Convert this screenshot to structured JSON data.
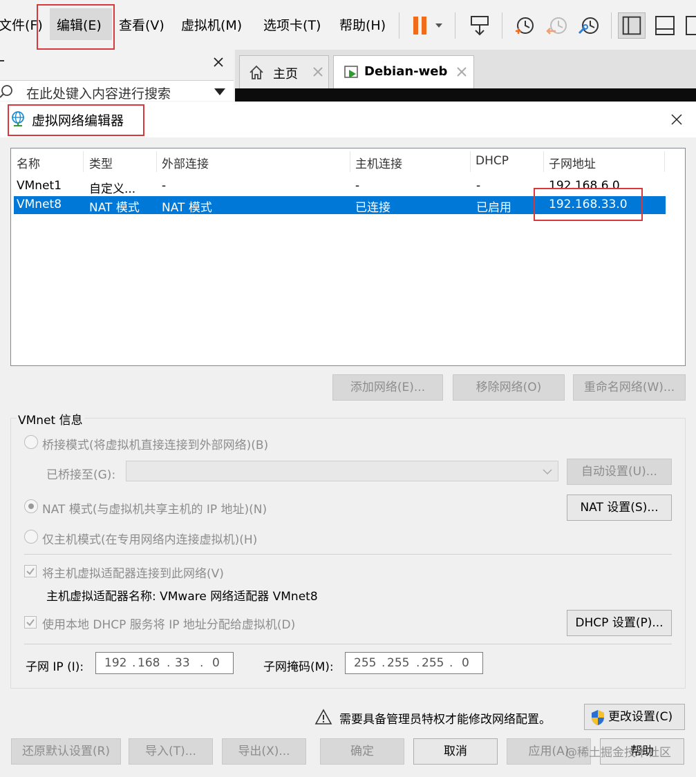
{
  "menubar": {
    "items": [
      "文件(F)",
      "编辑(E)",
      "查看(V)",
      "虚拟机(M)",
      "选项卡(T)",
      "帮助(H)"
    ]
  },
  "colors": {
    "accent": "#0078d7",
    "highlight_box": "#d9383a",
    "pause": "#ef6c1a"
  },
  "library": {
    "search_placeholder": "在此处键入内容进行搜索"
  },
  "tabs": [
    {
      "label": "主页"
    },
    {
      "label": "Debian-web"
    }
  ],
  "dialog": {
    "title": "虚拟网络编辑器",
    "columns": [
      "名称",
      "类型",
      "外部连接",
      "主机连接",
      "DHCP",
      "子网地址"
    ],
    "rows": [
      {
        "name": "VMnet1",
        "type": "自定义...",
        "external": "-",
        "host": "-",
        "dhcp": "-",
        "subnet": "192.168.6.0"
      },
      {
        "name": "VMnet8",
        "type": "NAT 模式",
        "external": "NAT 模式",
        "host": "已连接",
        "dhcp": "已启用",
        "subnet": "192.168.33.0"
      }
    ],
    "list_buttons": {
      "add": "添加网络(E)...",
      "remove": "移除网络(O)",
      "rename": "重命名网络(W)..."
    },
    "group": {
      "title": "VMnet 信息",
      "bridge_label": "桥接模式(将虚拟机直接连接到外部网络)(B)",
      "bridged_to_label": "已桥接至(G):",
      "auto_button": "自动设置(U)...",
      "nat_label": "NAT 模式(与虚拟机共享主机的 IP 地址)(N)",
      "nat_button": "NAT 设置(S)...",
      "hostonly_label": "仅主机模式(在专用网络内连接虚拟机)(H)",
      "connect_adapter_label": "将主机虚拟适配器连接到此网络(V)",
      "adapter_name_label": "主机虚拟适配器名称: VMware 网络适配器 VMnet8",
      "dhcp_label": "使用本地 DHCP 服务将 IP 地址分配给虚拟机(D)",
      "dhcp_button": "DHCP 设置(P)...",
      "subnet_ip_label": "子网 IP (I):",
      "subnet_ip": [
        "192",
        "168",
        "33",
        "0"
      ],
      "mask_label": "子网掩码(M):",
      "mask": [
        "255",
        "255",
        "255",
        "0"
      ]
    },
    "admin_notice": "需要具备管理员特权才能修改网络配置。",
    "change_settings": "更改设置(C)",
    "footer_buttons": {
      "restore": "还原默认设置(R)",
      "import": "导入(T)...",
      "export": "导出(X)...",
      "ok": "确定",
      "cancel": "取消",
      "apply": "应用(A)",
      "help": "帮助"
    },
    "watermark": "@稀土掘金技术社区"
  }
}
